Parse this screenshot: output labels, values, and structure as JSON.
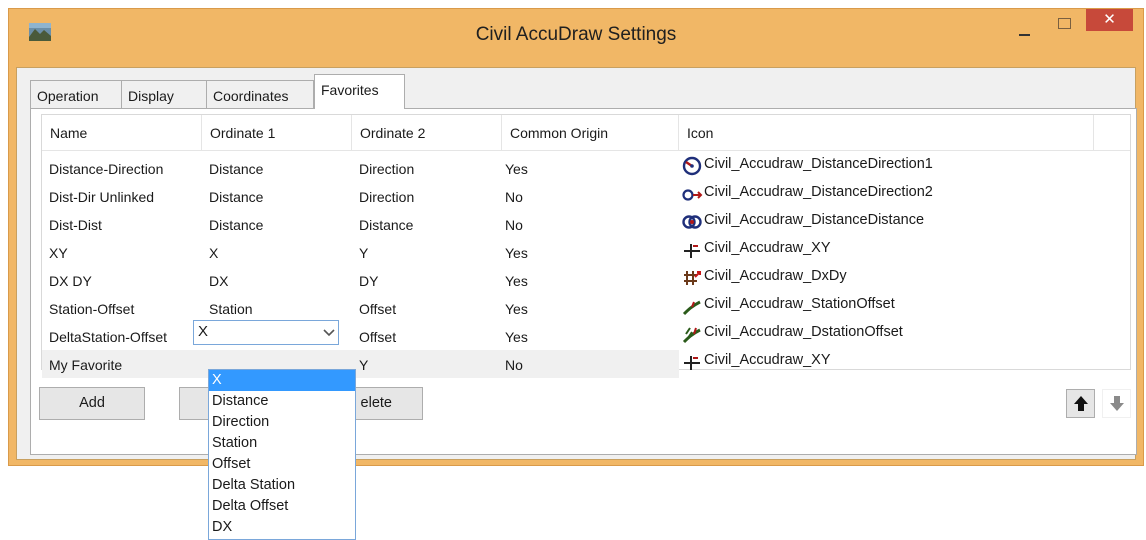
{
  "window": {
    "title": "Civil AccuDraw Settings",
    "close_glyph": "✕"
  },
  "tabs": [
    {
      "label": "Operation"
    },
    {
      "label": "Display"
    },
    {
      "label": "Coordinates"
    },
    {
      "label": "Favorites",
      "active": true
    }
  ],
  "columns": {
    "name": "Name",
    "ordinate1": "Ordinate 1",
    "ordinate2": "Ordinate 2",
    "common_origin": "Common Origin",
    "icon": "Icon"
  },
  "rows": [
    {
      "name": "Distance-Direction",
      "ord1": "Distance",
      "ord2": "Direction",
      "common": "Yes",
      "icon_name": "Civil_Accudraw_DistanceDirection1",
      "icon": "distance-direction-icon"
    },
    {
      "name": "Dist-Dir Unlinked",
      "ord1": "Distance",
      "ord2": "Direction",
      "common": "No",
      "icon_name": "Civil_Accudraw_DistanceDirection2",
      "icon": "distance-direction-unlinked-icon"
    },
    {
      "name": "Dist-Dist",
      "ord1": "Distance",
      "ord2": "Distance",
      "common": "No",
      "icon_name": "Civil_Accudraw_DistanceDistance",
      "icon": "distance-distance-icon"
    },
    {
      "name": "XY",
      "ord1": "X",
      "ord2": "Y",
      "common": "Yes",
      "icon_name": "Civil_Accudraw_XY",
      "icon": "xy-icon"
    },
    {
      "name": "DX DY",
      "ord1": "DX",
      "ord2": "DY",
      "common": "Yes",
      "icon_name": "Civil_Accudraw_DxDy",
      "icon": "dxdy-icon"
    },
    {
      "name": "Station-Offset",
      "ord1": "Station",
      "ord2": "Offset",
      "common": "Yes",
      "icon_name": "Civil_Accudraw_StationOffset",
      "icon": "station-offset-icon"
    },
    {
      "name": "DeltaStation-Offset",
      "ord1": "Delta Station",
      "ord2": "Offset",
      "common": "Yes",
      "icon_name": "Civil_Accudraw_DstationOffset",
      "icon": "delta-station-offset-icon"
    },
    {
      "name": "My Favorite",
      "ord1": "X",
      "ord2": "Y",
      "common": "No",
      "icon_name": "Civil_Accudraw_XY",
      "icon": "xy-icon"
    }
  ],
  "editor": {
    "value": "X",
    "options": [
      "X",
      "Distance",
      "Direction",
      "Station",
      "Offset",
      "Delta Station",
      "Delta Offset",
      "DX"
    ],
    "selected_index": 0
  },
  "buttons": {
    "add": "Add",
    "delete_visible": "elete"
  },
  "colors": {
    "title_bar": "#f1b766",
    "close_button": "#c7493a",
    "selection": "#3399ff",
    "combo_border": "#7aa7da"
  }
}
